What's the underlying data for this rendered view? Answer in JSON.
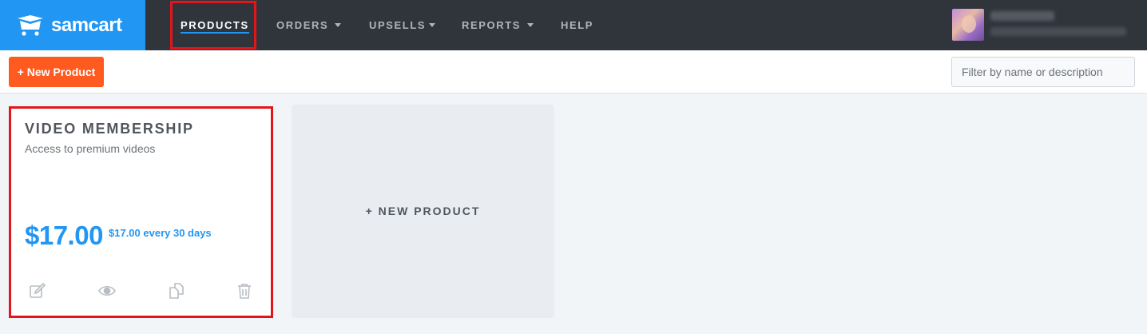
{
  "app": {
    "name": "samcart"
  },
  "nav": {
    "items": [
      {
        "label": "PRODUCTS",
        "active": true
      },
      {
        "label": "ORDERS",
        "dropdown": true
      },
      {
        "label": "UPSELLS",
        "dropdown": true
      },
      {
        "label": "REPORTS",
        "dropdown": true
      },
      {
        "label": "HELP"
      }
    ]
  },
  "toolbar": {
    "new_product_label": "+ New Product",
    "filter_placeholder": "Filter by name or description"
  },
  "products": [
    {
      "title": "VIDEO MEMBERSHIP",
      "description": "Access to premium videos",
      "price": "$17.00",
      "recurring": "$17.00 every 30 days",
      "actions": [
        "edit-icon",
        "eye-icon",
        "copy-icon",
        "trash-icon"
      ]
    }
  ],
  "new_product_card": {
    "label": "+ NEW PRODUCT"
  },
  "colors": {
    "brand": "#2196f3",
    "accent": "#ff5a1f",
    "highlight": "#e3151a",
    "nav_bg": "#30353c"
  }
}
